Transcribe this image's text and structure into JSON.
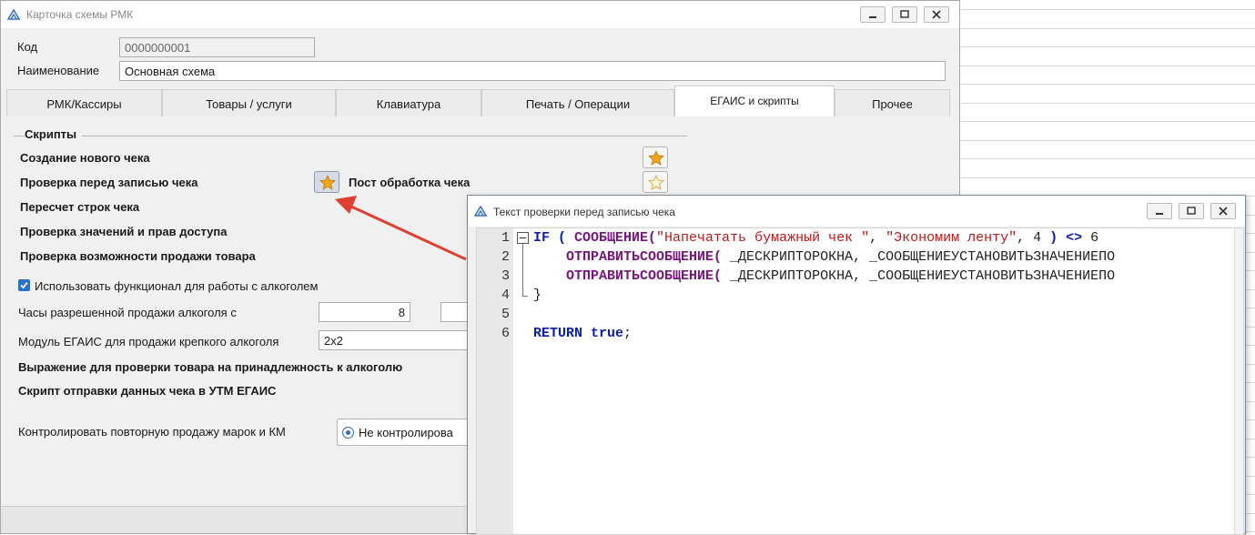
{
  "main_window": {
    "title": "Карточка схемы РМК",
    "code_label": "Код",
    "code_value": "0000000001",
    "name_label": "Наименование",
    "name_value": "Основная схема",
    "tabs": [
      {
        "label": "РМК/Кассиры"
      },
      {
        "label": "Товары / услуги"
      },
      {
        "label": "Клавиатура"
      },
      {
        "label": "Печать / Операции"
      },
      {
        "label": "ЕГАИС и скрипты",
        "active": true
      },
      {
        "label": "Прочее"
      }
    ],
    "scripts_group_title": "Скрипты",
    "scripts": {
      "new_check": "Создание нового чека",
      "pre_save_check": "Проверка перед записью чека",
      "post_process": "Пост обработка чека",
      "recalc_rows": "Пересчет строк чека",
      "check_values_rights": "Проверка значений и прав доступа",
      "check_sale_possibility": "Проверка возможности продажи товара"
    },
    "use_alcohol_label": "Использовать функционал для работы с алкоголем",
    "use_alcohol_checked": true,
    "alcohol_hours_label": "Часы разрешенной продажи алкоголя с",
    "alcohol_hours_from": "8",
    "egais_module_label": "Модуль ЕГАИС для продажи крепкого алкоголя",
    "egais_module_value": "2x2",
    "alcohol_expr_label": "Выражение для проверки товара на принадлежность к алкоголю",
    "utm_script_label": "Скрипт отправки данных чека в УТМ ЕГАИС",
    "repeat_sale_label": "Контролировать повторную продажу марок и КМ",
    "repeat_sale_option": "Не контролирова"
  },
  "editor_window": {
    "title": "Текст проверки перед записью чека",
    "line_numbers": [
      "1",
      "2",
      "3",
      "4",
      "5",
      "6"
    ],
    "lines": [
      [
        {
          "t": "IF",
          "c": "kw"
        },
        {
          "t": " ( ",
          "c": "kw"
        },
        {
          "t": "СООБЩЕНИЕ(",
          "c": "fn"
        },
        {
          "t": "\"Напечатать бумажный чек \"",
          "c": "str"
        },
        {
          "t": ", ",
          "c": "plain"
        },
        {
          "t": "\"Экономим ленту\"",
          "c": "str"
        },
        {
          "t": ", 4 ",
          "c": "plain"
        },
        {
          "t": ") <> ",
          "c": "kw"
        },
        {
          "t": "6",
          "c": "plain"
        }
      ],
      [
        {
          "t": "    ",
          "c": "plain"
        },
        {
          "t": "ОТПРАВИТЬСООБЩЕНИЕ(",
          "c": "fn"
        },
        {
          "t": " _ДЕСКРИПТОРОКНА, _СООБЩЕНИЕУСТАНОВИТЬЗНАЧЕНИЕПО",
          "c": "plain"
        }
      ],
      [
        {
          "t": "    ",
          "c": "plain"
        },
        {
          "t": "ОТПРАВИТЬСООБЩЕНИЕ(",
          "c": "fn"
        },
        {
          "t": " _ДЕСКРИПТОРОКНА, _СООБЩЕНИЕУСТАНОВИТЬЗНАЧЕНИЕПО",
          "c": "plain"
        }
      ],
      [
        {
          "t": "}",
          "c": "plain"
        }
      ],
      [],
      [
        {
          "t": "RETURN",
          "c": "kw"
        },
        {
          "t": " ",
          "c": "plain"
        },
        {
          "t": "true",
          "c": "kw"
        },
        {
          "t": ";",
          "c": "plain"
        }
      ]
    ]
  },
  "colors": {
    "accent": "#2b6fc9",
    "annotation_arrow": "#e0402f",
    "keyword": "#0a1fa8",
    "function": "#7a1680",
    "string": "#c01818",
    "star": "#f2a516"
  },
  "icons": [
    "app-logo-icon",
    "minimize-icon",
    "maximize-icon",
    "close-icon",
    "star-icon",
    "fold-collapse-icon"
  ]
}
